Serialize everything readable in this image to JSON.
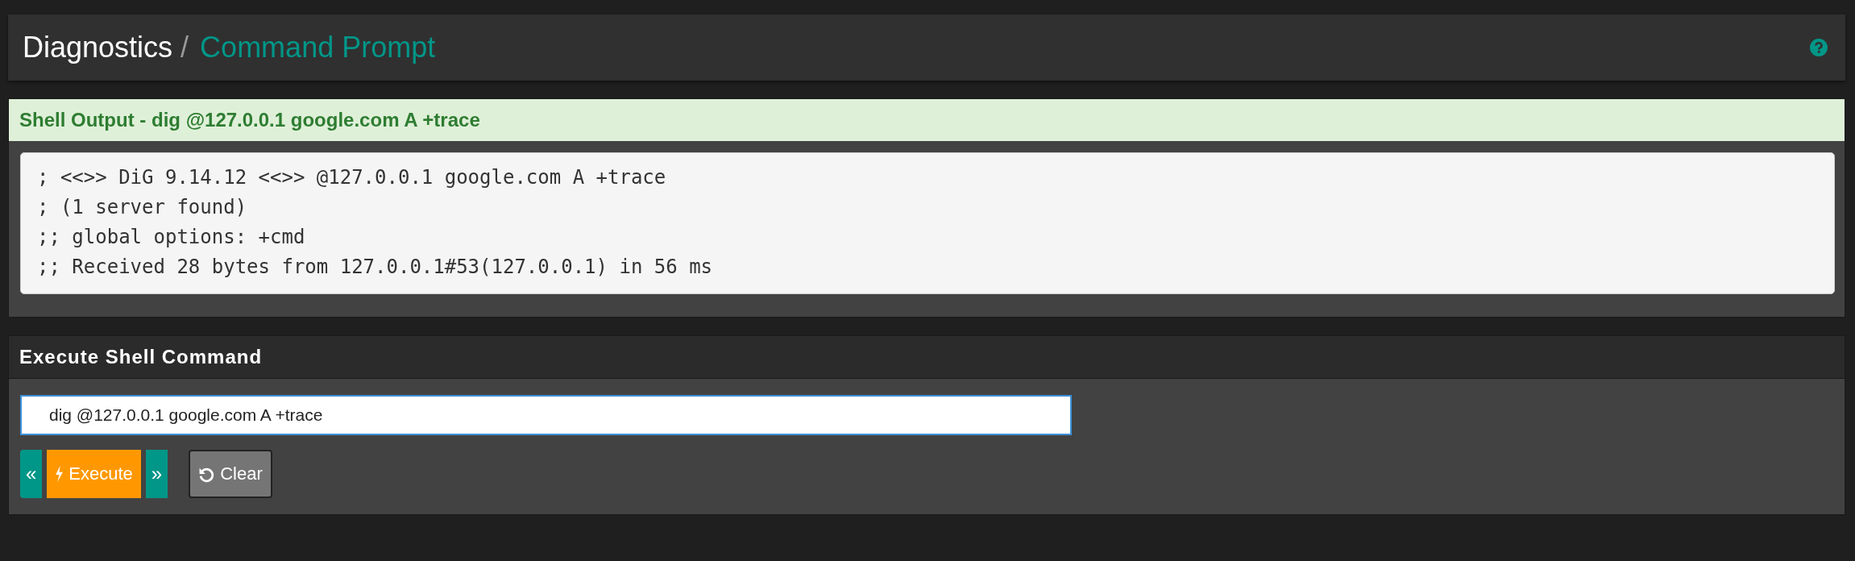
{
  "breadcrumb": {
    "items": [
      "Diagnostics",
      "Command Prompt"
    ],
    "separator": "/"
  },
  "shell_output": {
    "title": "Shell Output - dig @127.0.0.1 google.com A +trace",
    "lines": [
      "; <<>> DiG 9.14.12 <<>> @127.0.0.1 google.com A +trace",
      "; (1 server found)",
      ";; global options: +cmd",
      ";; Received 28 bytes from 127.0.0.1#53(127.0.0.1) in 56 ms"
    ]
  },
  "execute_panel": {
    "title": "Execute Shell Command",
    "command": "dig @127.0.0.1 google.com A +trace",
    "buttons": [
      {
        "kind": "prev",
        "label": "«"
      },
      {
        "kind": "execute",
        "label": "Execute"
      },
      {
        "kind": "next",
        "label": "»"
      },
      {
        "kind": "clear",
        "label": "Clear"
      }
    ]
  }
}
